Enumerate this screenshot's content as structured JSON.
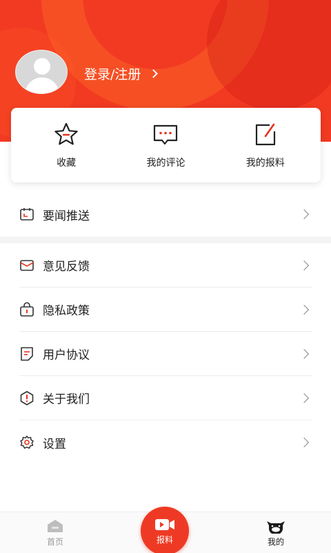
{
  "header": {
    "login_text": "登录/注册"
  },
  "quick_actions": [
    {
      "label": "收藏",
      "icon": "star-icon"
    },
    {
      "label": "我的评论",
      "icon": "comment-icon"
    },
    {
      "label": "我的报料",
      "icon": "edit-icon"
    }
  ],
  "menu": {
    "news_push": {
      "label": "要闻推送",
      "icon": "calendar-icon"
    },
    "items": [
      {
        "label": "意见反馈",
        "icon": "mail-icon"
      },
      {
        "label": "隐私政策",
        "icon": "lock-icon"
      },
      {
        "label": "用户协议",
        "icon": "document-icon"
      },
      {
        "label": "关于我们",
        "icon": "info-icon"
      },
      {
        "label": "设置",
        "icon": "gear-icon"
      }
    ]
  },
  "bottom_nav": {
    "home": {
      "label": "首页",
      "icon": "home-icon"
    },
    "report": {
      "label": "报料",
      "icon": "video-icon"
    },
    "mine": {
      "label": "我的",
      "icon": "cow-icon",
      "active": true
    }
  },
  "colors": {
    "brand_red": "#f23a22",
    "nav_red": "#ee3a24"
  }
}
